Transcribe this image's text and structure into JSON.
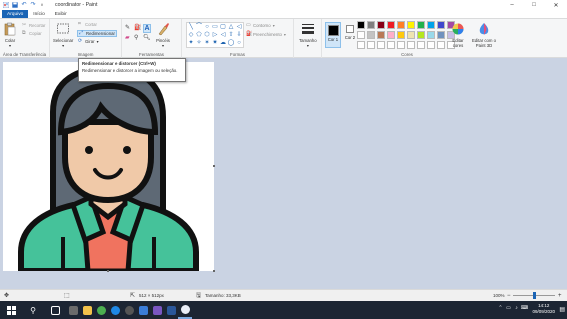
{
  "window": {
    "title": "coordinator - Paint",
    "minimize": "–",
    "maximize": "□",
    "close": "✕"
  },
  "tabs": [
    {
      "label": "Arquivo"
    },
    {
      "label": "Início"
    },
    {
      "label": "Exibir"
    }
  ],
  "ribbon": {
    "clipboard": {
      "paste_label": "Colar",
      "cut_label": "Recortar",
      "copy_label": "Copiar",
      "group_label": "Área de Transferência"
    },
    "image": {
      "select_label": "Selecionar",
      "crop_label": "Cortar",
      "resize_label": "Redimensionar",
      "rotate_label": "Girar",
      "group_label": "Imagem"
    },
    "tools": {
      "group_label": "Ferramentas",
      "brushes_label": "Pincéis"
    },
    "shapes": {
      "group_label": "Formas",
      "outline_label": "Contorno",
      "fill_label": "Preenchimento",
      "icons": [
        "╲",
        "⌒",
        "○",
        "▭",
        "▢",
        "△",
        "◁",
        "◇",
        "⬠",
        "⬡",
        "▷",
        "◁",
        "⇧",
        "⇩",
        "✦",
        "✧",
        "✶",
        "✷",
        "☁",
        "◯",
        "○"
      ]
    },
    "size": {
      "size_label": "Tamanho"
    },
    "colors": {
      "color1_label": "Cor 1",
      "color2_label": "Cor 2",
      "group_label": "Cores",
      "edit_label": "Editar cores",
      "paint3d_label": "Editar com o Paint 3D",
      "color1": "#000000",
      "color2": "#ffffff",
      "palette": [
        "#000000",
        "#7f7f7f",
        "#880015",
        "#ed1c24",
        "#ff7f27",
        "#fff200",
        "#22b14c",
        "#00a2e8",
        "#3f48cc",
        "#a349a4",
        "#ffffff",
        "#c3c3c3",
        "#b97a57",
        "#ffaec9",
        "#ffc90e",
        "#efe4b0",
        "#b5e61d",
        "#99d9ea",
        "#7092be",
        "#c8bfe7",
        "#ffffff",
        "#ffffff",
        "#ffffff",
        "#ffffff",
        "#ffffff",
        "#ffffff",
        "#ffffff",
        "#ffffff",
        "#ffffff",
        "#ffffff"
      ]
    }
  },
  "tooltip": {
    "title": "Redimensionar e distorcer (Ctrl+W)",
    "body": "Redimensionar e distorcer a imagem ou seleção."
  },
  "statusbar": {
    "dimensions": "512 × 512px",
    "file_size": "Tamanho: 33,3KB",
    "zoom": "100%",
    "zoom_fraction": 0.5
  },
  "taskbar": {
    "time": "14:12",
    "date": "09/09/2020"
  }
}
